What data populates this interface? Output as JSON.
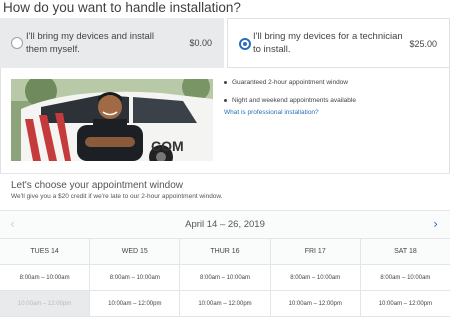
{
  "heading": "How do you want to handle installation?",
  "options": [
    {
      "label": "I'll bring my devices and install them myself.",
      "price": "$0.00",
      "selected": false
    },
    {
      "label": "I'll bring my devices for a technician to install.",
      "price": "$25.00",
      "selected": true
    }
  ],
  "install_info": {
    "bullets": [
      "Guaranteed 2-hour appointment window",
      "Night and weekend appointments available"
    ],
    "link": "What is professional installation?",
    "photo_text": "COM"
  },
  "appointment": {
    "title": "Let's choose your appointment window",
    "subtitle": "We'll give you a $20 credit if we're late to our 2-hour appointment window.",
    "date_range": "April 14 – 26, 2019",
    "prev_icon": "chevron-left-icon",
    "next_icon": "chevron-right-icon",
    "days": [
      {
        "label": "TUES 14",
        "slots": [
          {
            "time": "8:00am – 10:00am",
            "available": true
          },
          {
            "time": "10:00am – 12:00pm",
            "available": false
          }
        ]
      },
      {
        "label": "WED 15",
        "slots": [
          {
            "time": "8:00am – 10:00am",
            "available": true
          },
          {
            "time": "10:00am – 12:00pm",
            "available": true
          }
        ]
      },
      {
        "label": "THUR 16",
        "slots": [
          {
            "time": "8:00am – 10:00am",
            "available": true
          },
          {
            "time": "10:00am – 12:00pm",
            "available": true
          }
        ]
      },
      {
        "label": "FRI 17",
        "slots": [
          {
            "time": "8:00am – 10:00am",
            "available": true
          },
          {
            "time": "10:00am – 12:00pm",
            "available": true
          }
        ]
      },
      {
        "label": "SAT 18",
        "slots": [
          {
            "time": "8:00am – 10:00am",
            "available": true
          },
          {
            "time": "10:00am – 12:00pm",
            "available": true
          }
        ]
      }
    ]
  },
  "colors": {
    "accent": "#2a6ebb",
    "selected_bg": "#e9eaeb",
    "disabled_text": "#b7babd"
  }
}
